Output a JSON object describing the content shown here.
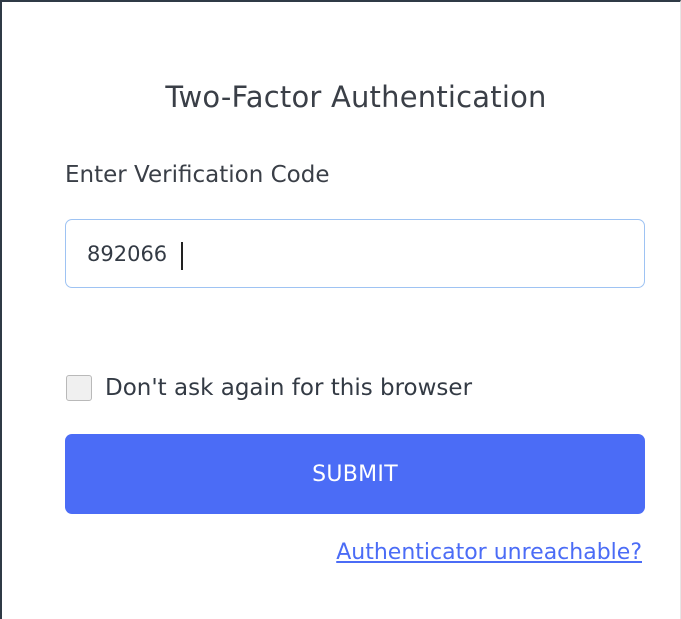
{
  "dialog": {
    "title": "Two-Factor Authentication",
    "code_label": "Enter Verification Code",
    "code_value": "892066",
    "remember_label": "Don't ask again for this browser",
    "remember_checked": false,
    "submit_label": "SUBMIT",
    "help_link": "Authenticator unreachable?"
  },
  "colors": {
    "accent": "#4b6cf6",
    "input_border": "#9ec3f3",
    "text": "#3a3f47"
  },
  "icons": {
    "checkbox": "checkbox-unchecked-icon"
  }
}
